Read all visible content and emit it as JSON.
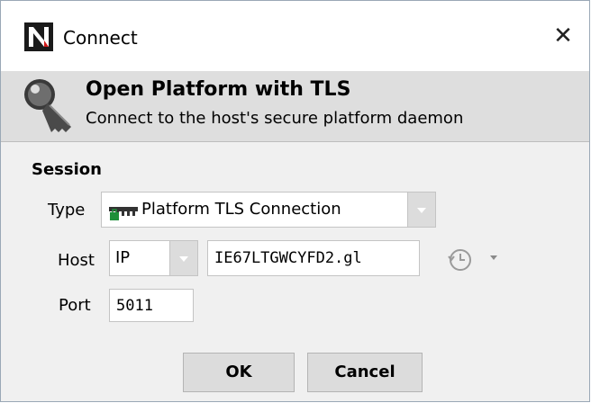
{
  "window": {
    "title": "Connect",
    "close_glyph": "✕",
    "app_icon": "niagara-n-icon"
  },
  "header": {
    "icon": "key-icon",
    "title": "Open Platform with TLS",
    "subtitle": "Connect to the host's secure platform daemon"
  },
  "session": {
    "label": "Session",
    "type": {
      "label": "Type",
      "value": "Platform TLS Connection",
      "icon": "platform-key-icon"
    },
    "host": {
      "label": "Host",
      "mode": "IP",
      "value": "IE67LTGWCYFD2.gl",
      "history_icon": "history-clock-icon"
    },
    "port": {
      "label": "Port",
      "value": "5011"
    }
  },
  "buttons": {
    "ok": "OK",
    "cancel": "Cancel"
  }
}
